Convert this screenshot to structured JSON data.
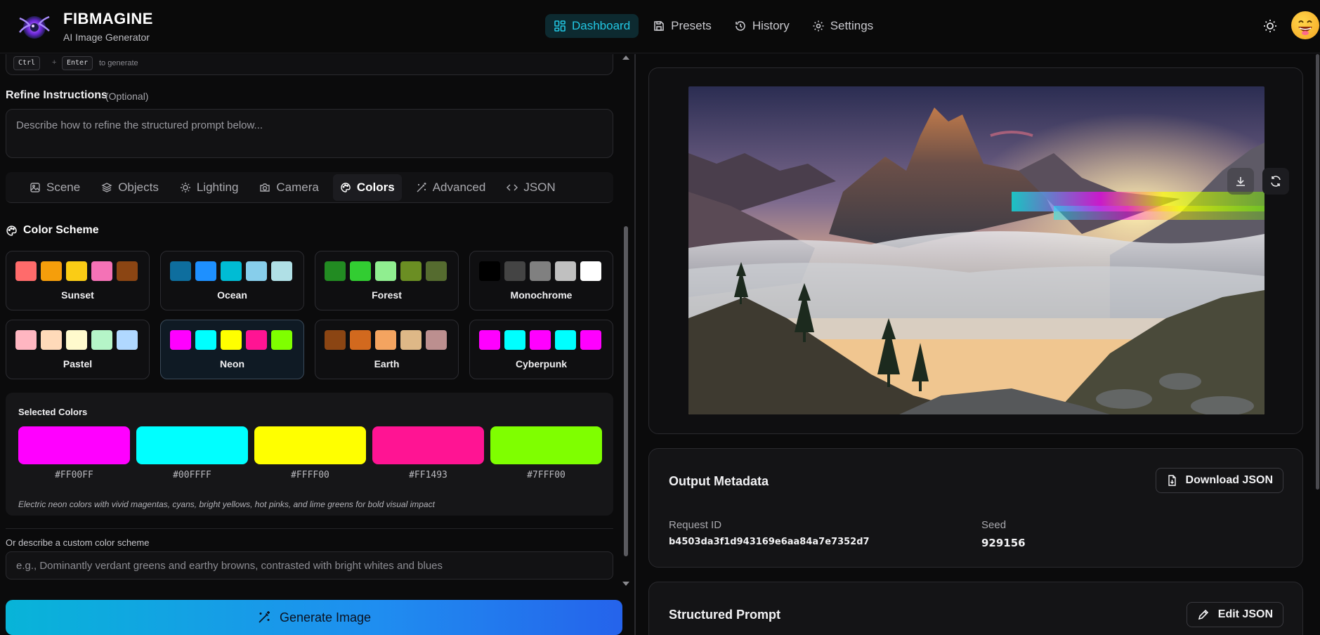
{
  "header": {
    "brand_title": "FIBMAGINE",
    "brand_subtitle": "AI Image Generator",
    "nav": [
      {
        "label": "Dashboard",
        "icon": "dashboard-icon",
        "active": true
      },
      {
        "label": "Presets",
        "icon": "save-icon",
        "active": false
      },
      {
        "label": "History",
        "icon": "history-icon",
        "active": false
      },
      {
        "label": "Settings",
        "icon": "gear-icon",
        "active": false
      }
    ],
    "accent_color": "#22c7e3"
  },
  "prompt": {
    "shortcut_key1": "Ctrl",
    "shortcut_plus": "+",
    "shortcut_key2": "Enter",
    "shortcut_hint": "to generate"
  },
  "refine": {
    "label": "Refine Instructions",
    "optional": "(Optional)",
    "placeholder": "Describe how to refine the structured prompt below..."
  },
  "tabs": [
    {
      "label": "Scene",
      "icon": "image-icon",
      "active": false
    },
    {
      "label": "Objects",
      "icon": "layers-icon",
      "active": false
    },
    {
      "label": "Lighting",
      "icon": "sun-icon",
      "active": false
    },
    {
      "label": "Camera",
      "icon": "camera-icon",
      "active": false
    },
    {
      "label": "Colors",
      "icon": "palette-icon",
      "active": true
    },
    {
      "label": "Advanced",
      "icon": "wand-icon",
      "active": false
    },
    {
      "label": "JSON",
      "icon": "code-icon",
      "active": false
    }
  ],
  "color_scheme": {
    "title": "Color Scheme",
    "schemes": [
      {
        "name": "Sunset",
        "colors": [
          "#FF6B6B",
          "#F59E0B",
          "#FACC15",
          "#F472B6",
          "#8B4513"
        ],
        "active": false
      },
      {
        "name": "Ocean",
        "colors": [
          "#0E6E9E",
          "#1E90FF",
          "#00BCD4",
          "#87CEEB",
          "#B0E0E6"
        ],
        "active": false
      },
      {
        "name": "Forest",
        "colors": [
          "#228B22",
          "#32CD32",
          "#90EE90",
          "#6B8E23",
          "#556B2F"
        ],
        "active": false
      },
      {
        "name": "Monochrome",
        "colors": [
          "#000000",
          "#444444",
          "#808080",
          "#C0C0C0",
          "#FFFFFF"
        ],
        "active": false
      },
      {
        "name": "Pastel",
        "colors": [
          "#FFB6C1",
          "#FFDAB9",
          "#FFFACD",
          "#B5F5C8",
          "#B0D8FF"
        ],
        "active": false
      },
      {
        "name": "Neon",
        "colors": [
          "#FF00FF",
          "#00FFFF",
          "#FFFF00",
          "#FF1493",
          "#7FFF00"
        ],
        "active": true
      },
      {
        "name": "Earth",
        "colors": [
          "#8B4513",
          "#D2691E",
          "#F4A460",
          "#DEB887",
          "#BC8F8F"
        ],
        "active": false
      },
      {
        "name": "Cyberpunk",
        "colors": [
          "#FF00FF",
          "#00FFFF",
          "#FF00FF",
          "#00FFFF",
          "#FF00FF"
        ],
        "active": false
      }
    ]
  },
  "selected_colors": {
    "title": "Selected Colors",
    "colors": [
      "#FF00FF",
      "#00FFFF",
      "#FFFF00",
      "#FF1493",
      "#7FFF00"
    ],
    "description": "Electric neon colors with vivid magentas, cyans, bright yellows, hot pinks, and lime greens for bold visual impact"
  },
  "custom_scheme": {
    "label": "Or describe a custom color scheme",
    "placeholder": "e.g., Dominantly verdant greens and earthy browns, contrasted with bright whites and blues"
  },
  "generate_button": "Generate Image",
  "output_metadata": {
    "title": "Output Metadata",
    "download_label": "Download JSON",
    "request_id_label": "Request ID",
    "request_id": "b4503da3f1d943169e6aa84a7e7352d7",
    "seed_label": "Seed",
    "seed": "929156"
  },
  "structured_prompt": {
    "title": "Structured Prompt",
    "edit_label": "Edit JSON"
  }
}
